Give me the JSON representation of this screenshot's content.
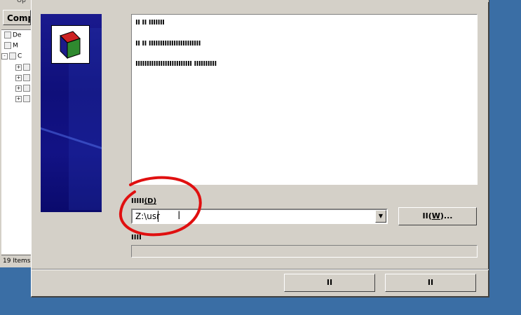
{
  "background_window": {
    "title_fragment": "Op",
    "toolbar_button": "Comp",
    "tree_items": [
      {
        "label": "De",
        "expander": ""
      },
      {
        "label": "M",
        "expander": ""
      },
      {
        "label": "C",
        "expander": "-"
      },
      {
        "label": "",
        "expander": "+"
      },
      {
        "label": "",
        "expander": "+"
      },
      {
        "label": "",
        "expander": "+"
      },
      {
        "label": "",
        "expander": "+"
      }
    ],
    "status_text": "19 Items"
  },
  "dialog": {
    "info_lines": [
      "II II IIIIIII",
      "II II IIIIIIIIIIIIIIIIIIIIIII",
      "IIIIIIIIIIIIIIIIIIIIIIIII IIIIIIIIII"
    ],
    "directory_label": "IIIII",
    "directory_hotkey": "(D)",
    "directory_value": "Z:\\usr",
    "browse_button_prefix": "II(",
    "browse_button_hotkey": "W",
    "browse_button_suffix": ")...",
    "progress_label": "IIII",
    "progress_fraction": 0,
    "ok_button": "II",
    "cancel_button": "II"
  },
  "colors": {
    "desktop": "#3a6ea5",
    "dialog_face": "#d4d0c8",
    "banner": "#1a1a8e",
    "annotation": "#e01010"
  }
}
